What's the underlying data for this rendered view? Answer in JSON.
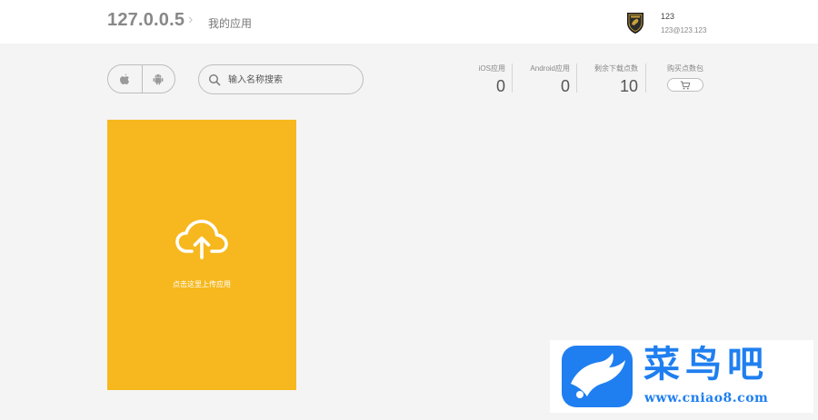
{
  "header": {
    "brand": "127.0.0.5",
    "separator": "›",
    "breadcrumb": "我的应用",
    "user": {
      "name": "123",
      "email": "123@123.123"
    }
  },
  "toolbar": {
    "platforms": [
      {
        "icon": "apple-icon"
      },
      {
        "icon": "android-icon"
      }
    ],
    "search": {
      "icon": "search-icon",
      "placeholder": "输入名称搜索"
    }
  },
  "stats": [
    {
      "label": "iOS应用",
      "value": "0"
    },
    {
      "label": "Android应用",
      "value": "0"
    },
    {
      "label": "剩余下载点数",
      "value": "10"
    }
  ],
  "buy": {
    "label": "购买点数包",
    "icon": "cart-icon"
  },
  "upload_card": {
    "icon": "cloud-upload-icon",
    "text": "点击这里上传应用",
    "color": "#f6b81e"
  },
  "watermark": {
    "icon": "bird-logo-icon",
    "title": "菜鸟吧",
    "url": "www.cniao8.com",
    "color": "#1f7ff0"
  }
}
